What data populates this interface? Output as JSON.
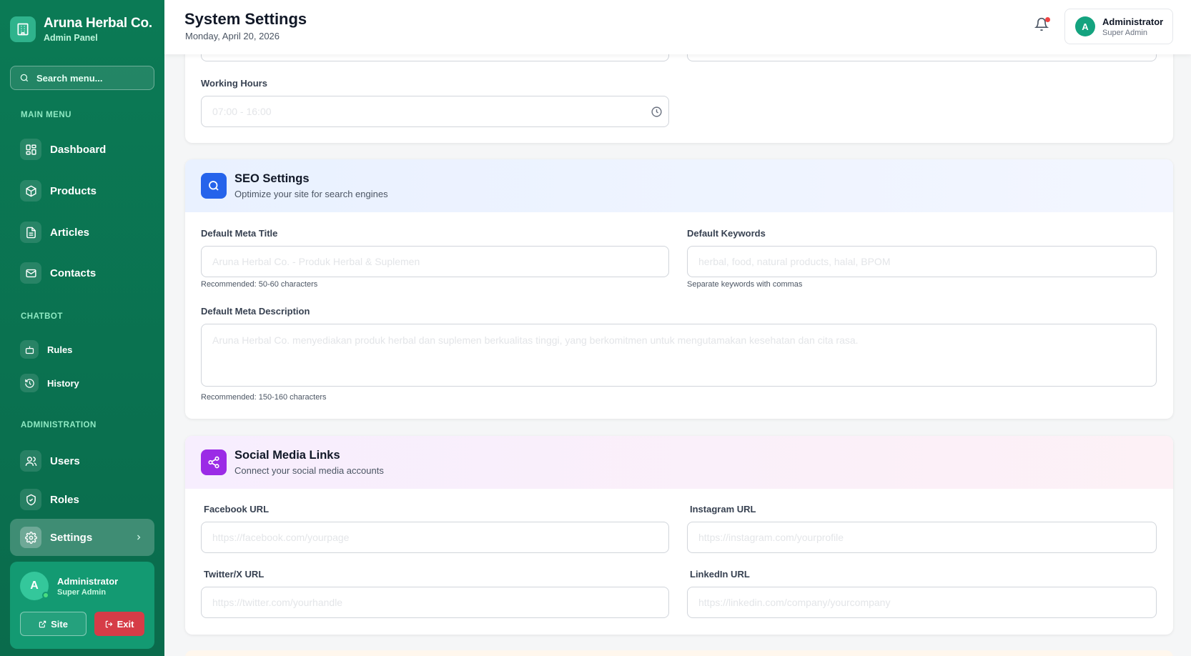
{
  "brand": {
    "title": "Aruna Herbal Co.",
    "subtitle": "Admin Panel"
  },
  "search": {
    "placeholder": "Search menu..."
  },
  "sections": {
    "main": "MAIN MENU",
    "chatbot": "CHATBOT",
    "admin": "ADMINISTRATION"
  },
  "nav": {
    "dashboard": "Dashboard",
    "products": "Products",
    "articles": "Articles",
    "contacts": "Contacts",
    "rules": "Rules",
    "history": "History",
    "users": "Users",
    "roles": "Roles",
    "settings": "Settings"
  },
  "sidebar_user": {
    "initial": "A",
    "name": "Administrator",
    "role": "Super Admin",
    "site_label": "Site",
    "exit_label": "Exit"
  },
  "header": {
    "title": "System Settings",
    "date": "Monday, April 20, 2026",
    "user": {
      "initial": "A",
      "name": "Administrator",
      "role": "Super Admin"
    }
  },
  "general": {
    "working_hours_label": "Working Hours",
    "working_hours_placeholder": "07:00 - 16:00"
  },
  "seo": {
    "title": "SEO Settings",
    "subtitle": "Optimize your site for search engines",
    "meta_title_label": "Default Meta Title",
    "meta_title_placeholder": "Aruna Herbal Co. - Produk Herbal & Suplemen",
    "meta_title_hint": "Recommended: 50-60 characters",
    "keywords_label": "Default Keywords",
    "keywords_placeholder": "herbal, food, natural products, halal, BPOM",
    "keywords_hint": "Separate keywords with commas",
    "description_label": "Default Meta Description",
    "description_placeholder": "Aruna Herbal Co. menyediakan produk herbal dan suplemen berkualitas tinggi, yang berkomitmen untuk mengutamakan kesehatan dan cita rasa.",
    "description_hint": "Recommended: 150-160 characters"
  },
  "social": {
    "title": "Social Media Links",
    "subtitle": "Connect your social media accounts",
    "facebook_label": "Facebook URL",
    "facebook_placeholder": "https://facebook.com/yourpage",
    "instagram_label": "Instagram URL",
    "instagram_placeholder": "https://instagram.com/yourprofile",
    "twitter_label": "Twitter/X URL",
    "twitter_placeholder": "https://twitter.com/yourhandle",
    "linkedin_label": "LinkedIn URL",
    "linkedin_placeholder": "https://linkedin.com/company/yourcompany"
  },
  "colors": {
    "sidebar": "#0b7a55",
    "accent": "#14a37f",
    "seo_icon": "#2563eb",
    "social_icon": "#9b2be6",
    "exit": "#d63c47"
  }
}
